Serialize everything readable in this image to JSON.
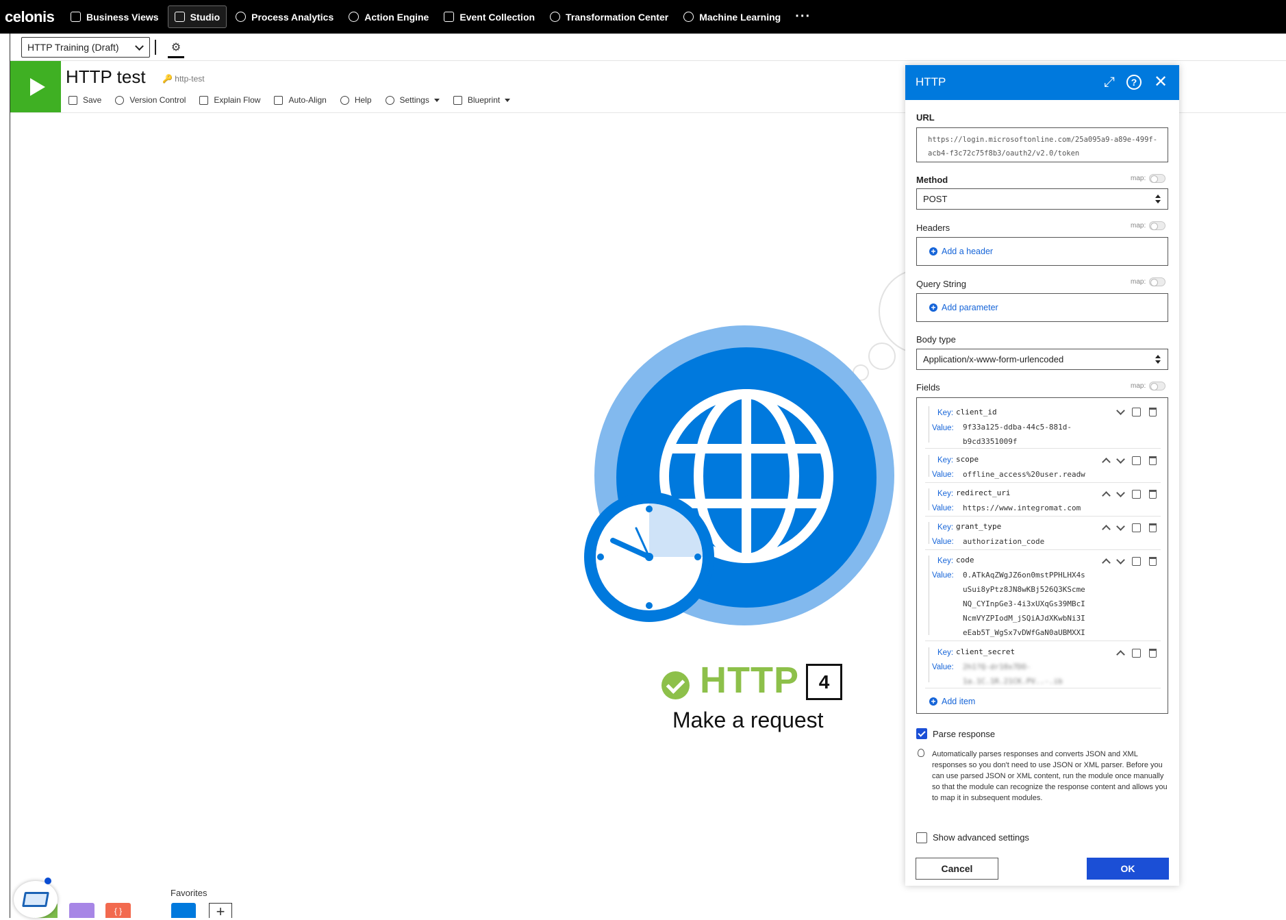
{
  "nav": {
    "logo": "celonis",
    "items": [
      {
        "label": "Business Views",
        "active": false
      },
      {
        "label": "Studio",
        "active": true
      },
      {
        "label": "Process Analytics",
        "active": false
      },
      {
        "label": "Action Engine",
        "active": false
      },
      {
        "label": "Event Collection",
        "active": false
      },
      {
        "label": "Transformation Center",
        "active": false
      },
      {
        "label": "Machine Learning",
        "active": false
      }
    ],
    "more": "···"
  },
  "subbar": {
    "scenario_select": "HTTP Training (Draft)"
  },
  "scenario": {
    "title": "HTTP test",
    "slug": "http-test",
    "toolbar": {
      "save": "Save",
      "version_control": "Version Control",
      "explain_flow": "Explain Flow",
      "auto_align": "Auto-Align",
      "help": "Help",
      "settings": "Settings",
      "blueprint": "Blueprint"
    }
  },
  "module": {
    "name": "HTTP",
    "number": "4",
    "description": "Make a request",
    "colors": {
      "primary": "#0079dd",
      "light": "#82b9ee",
      "status": "#8dc04a"
    }
  },
  "bottom": {
    "favorites_label": "Favorites",
    "add": "+"
  },
  "panel": {
    "title": "HTTP",
    "url_label": "URL",
    "url_value": "https://login.microsoftonline.com/25a095a9-a89e-499f-acb4-f3c72c75f8b3/oauth2/v2.0/token",
    "map_label": "map:",
    "method_label": "Method",
    "method_value": "POST",
    "headers_label": "Headers",
    "add_header": "Add a header",
    "query_label": "Query String",
    "add_parameter": "Add parameter",
    "body_type_label": "Body type",
    "body_type_value": "Application/x-www-form-urlencoded",
    "fields_label": "Fields",
    "key_label": "Key:",
    "value_label": "Value:",
    "fields": [
      {
        "key": "client_id",
        "value": "9f33a125-ddba-44c5-881d-\nb9cd3351009f"
      },
      {
        "key": "scope",
        "value": "offline_access%20user.readw"
      },
      {
        "key": "redirect_uri",
        "value": "https://www.integromat.com"
      },
      {
        "key": "grant_type",
        "value": "authorization_code"
      },
      {
        "key": "code",
        "value": "0.ATkAqZWgJZ6on0mstPPHLHX4s\nuSui8yPtz8JN8wKBj526Q3KScme\nNQ_CYInpGe3-4i3xUXqGs39MBcI\nNcmVYZPIodM_jSQiAJdXKwbNi3I\neEab5T_WgSx7vDWfGaN0aUBMXXI"
      },
      {
        "key": "client_secret",
        "value": "2h1?Q-dr10x7DO-\n1a.1C.1R.21CK.PV..-.ib"
      }
    ],
    "add_item": "Add item",
    "parse_response_label": "Parse response",
    "parse_response_checked": true,
    "parse_hint": "Automatically parses responses and converts JSON and XML responses so you don't need to use JSON or XML parser. Before you can use parsed JSON or XML content, run the module once manually so that the module can recognize the response content and allows you to map it in subsequent modules.",
    "advanced_label": "Show advanced settings",
    "advanced_checked": false,
    "cancel": "Cancel",
    "ok": "OK"
  }
}
